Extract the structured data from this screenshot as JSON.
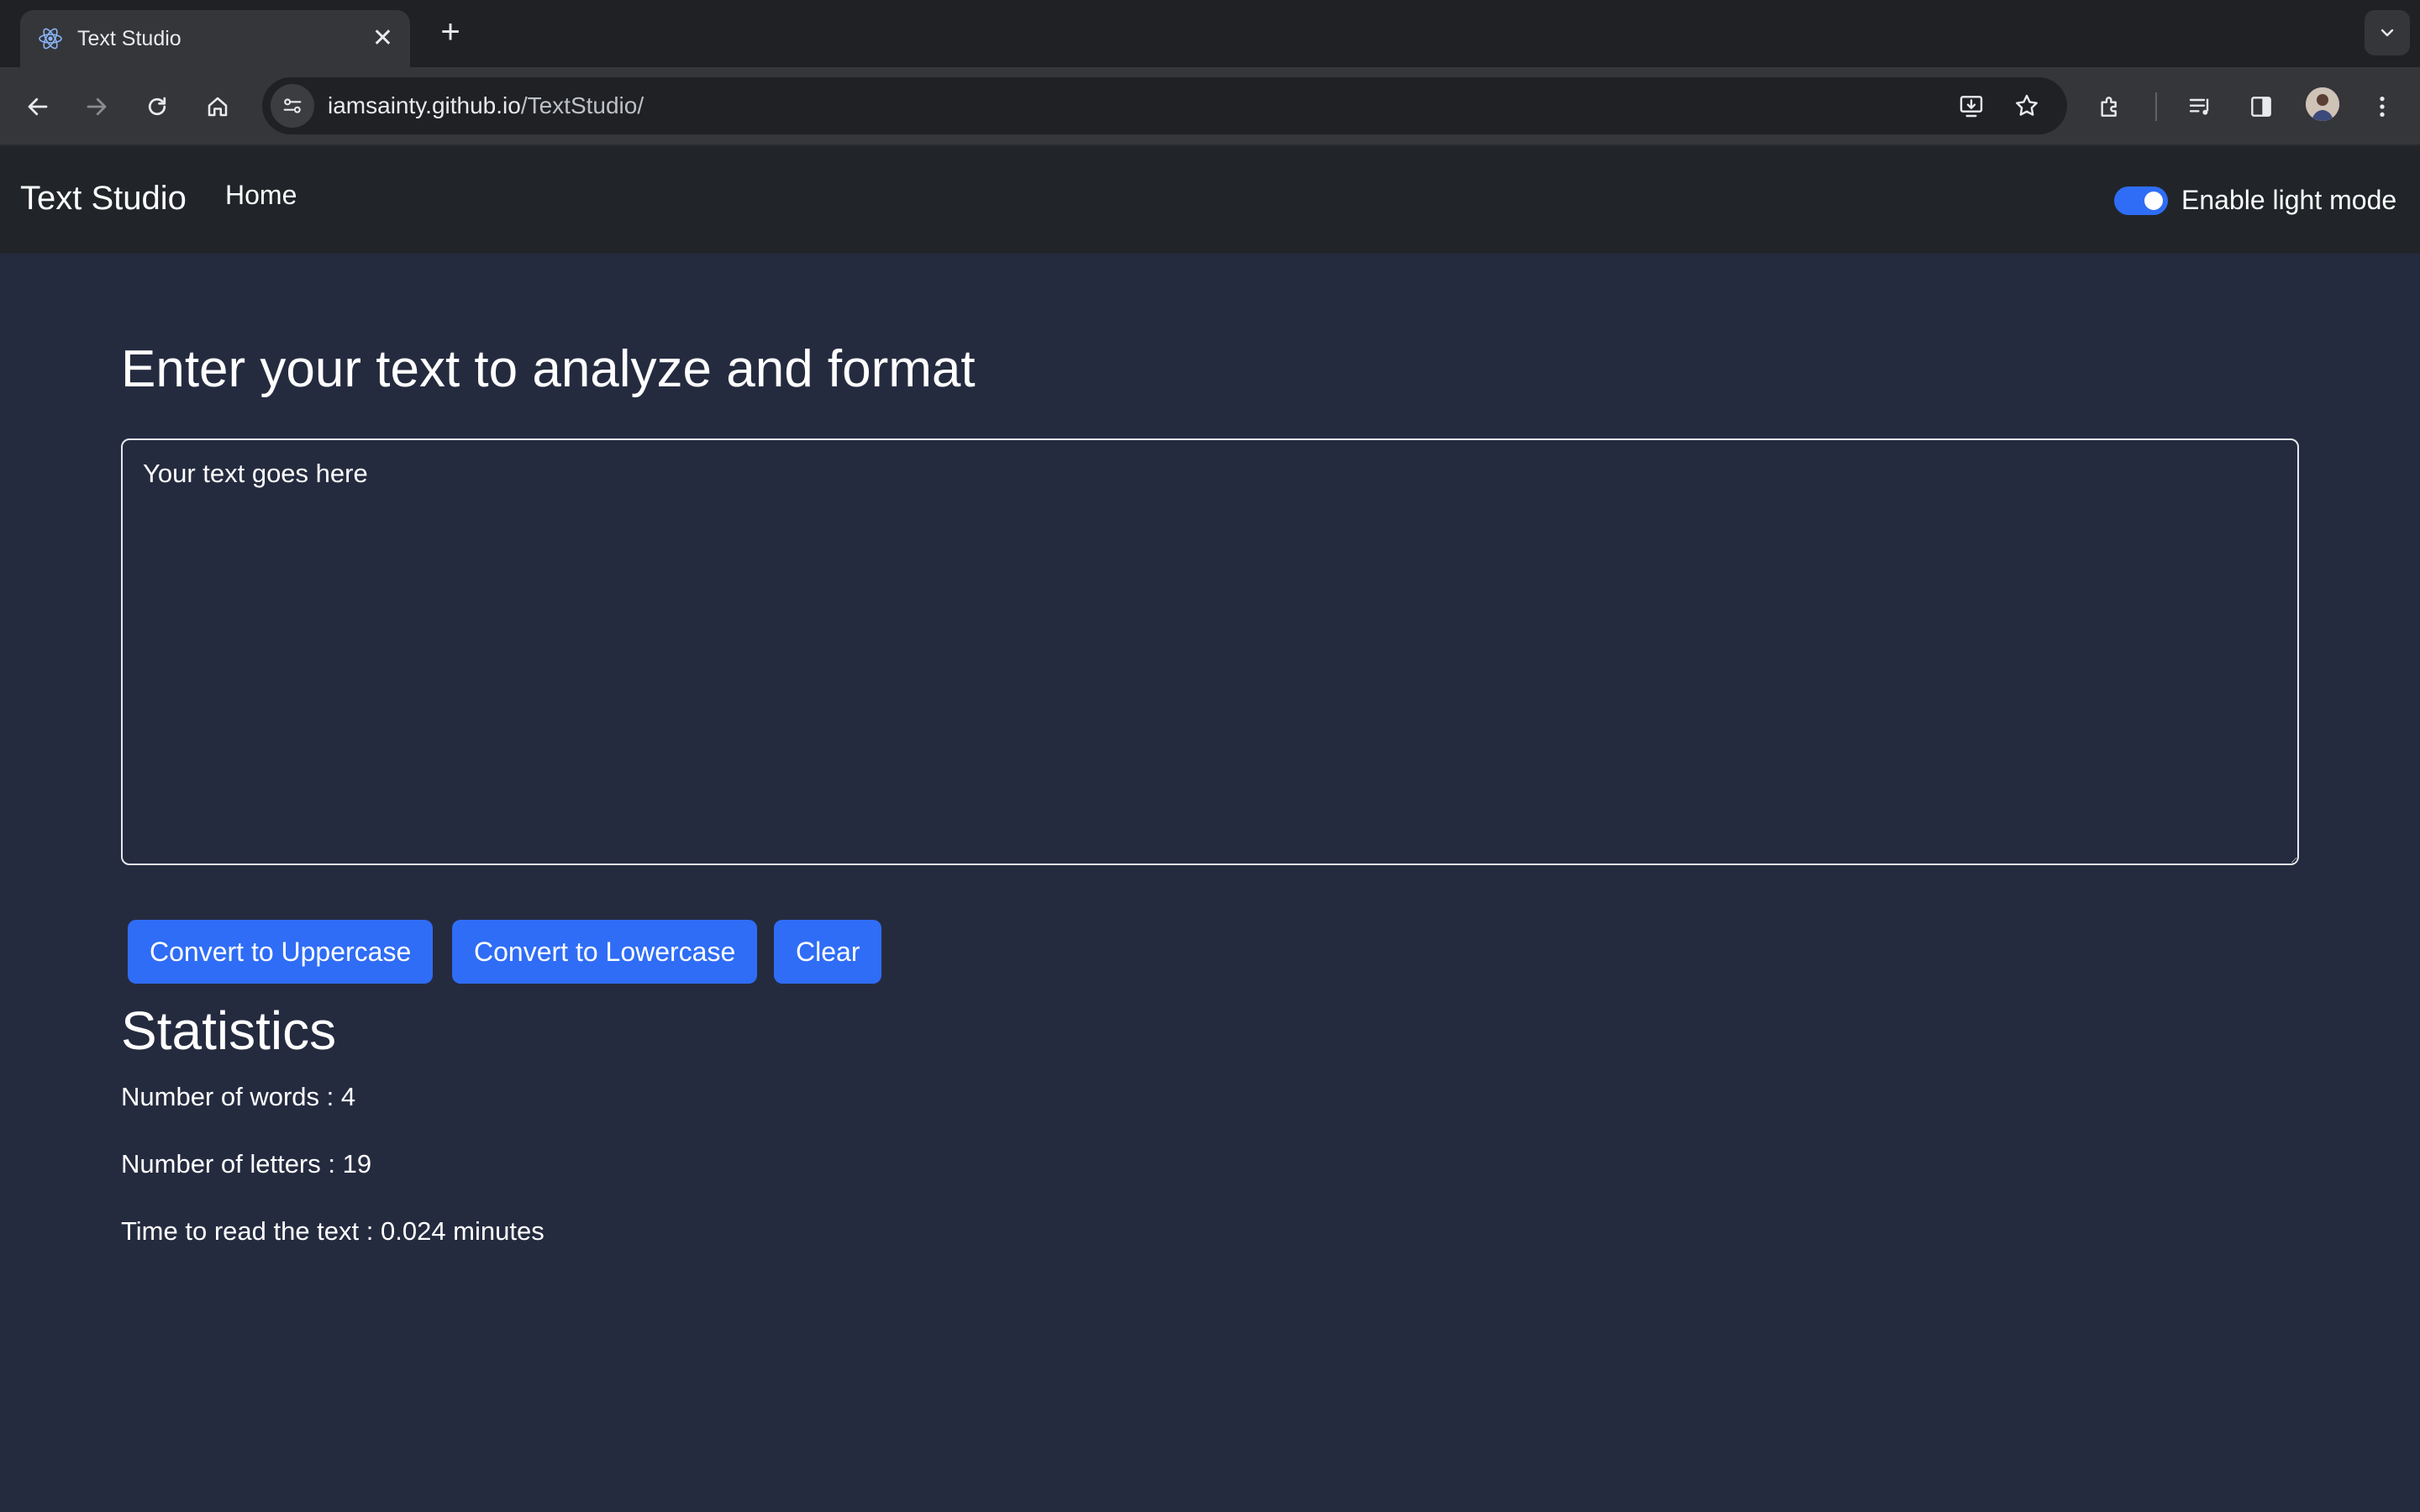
{
  "browser": {
    "tab_title": "Text Studio",
    "tab_close": "✕",
    "new_tab": "+",
    "url_host": "iamsainty.github.io",
    "url_path": "/TextStudio/"
  },
  "app": {
    "brand": "Text Studio",
    "nav_home": "Home",
    "toggle_label": "Enable light mode",
    "toggle_on": true,
    "accent_color": "#2f6df6",
    "background_color": "#252b3f",
    "navbar_color": "#212529"
  },
  "main": {
    "heading": "Enter your text to analyze and format",
    "textarea_placeholder": "Your text goes here",
    "buttons": {
      "uppercase": "Convert to Uppercase",
      "lowercase": "Convert to Lowercase",
      "clear": "Clear"
    }
  },
  "stats": {
    "heading": "Statistics",
    "words": "Number of words : 4",
    "letters": "Number of letters : 19",
    "read_time": "Time to read the text : 0.024 minutes"
  }
}
